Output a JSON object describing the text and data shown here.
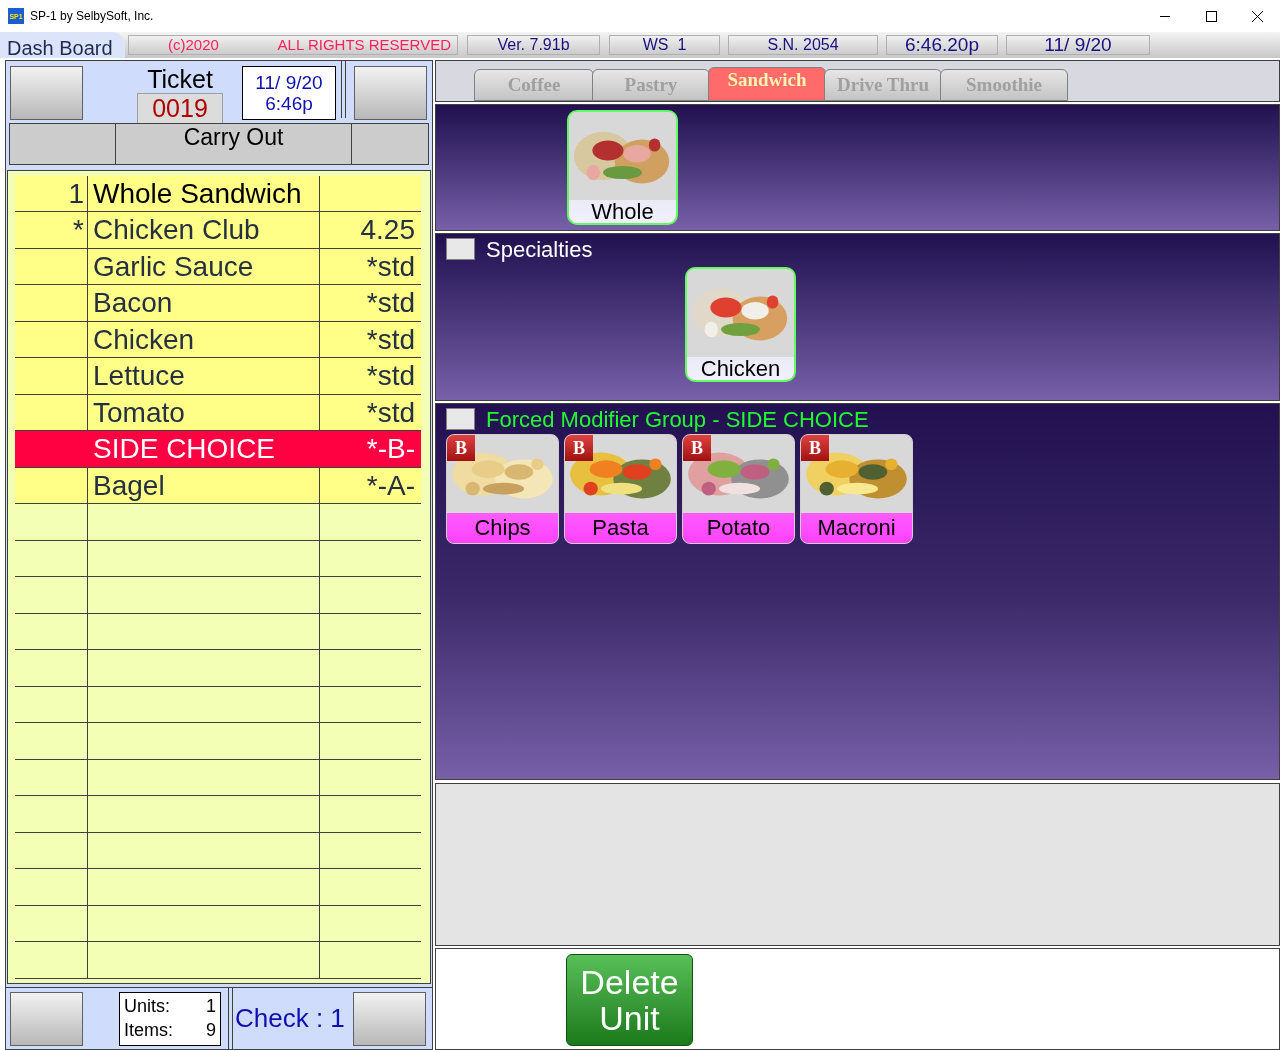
{
  "window": {
    "title": "SP-1 by SelbySoft, Inc.",
    "app_icon": "SP1"
  },
  "info_bar": {
    "dash_board": "Dash Board",
    "copyright": "(c)2020",
    "rights": "ALL RIGHTS RESERVED",
    "version": "Ver. 7.91b",
    "workstation": "WS  1",
    "serial": "S.N. 2054",
    "time": "6:46.20p",
    "date": "11/ 9/20"
  },
  "ticket": {
    "label": "Ticket",
    "number": "0019",
    "date": "11/ 9/20",
    "time": "6:46p",
    "order_type": "Carry Out"
  },
  "order_lines": [
    {
      "qty": "1",
      "name": "Whole Sandwich",
      "selected": false
    },
    {
      "qty": "*",
      "name": "Chicken Club",
      "price": "4.25",
      "selected": false
    },
    {
      "name": "Garlic Sauce",
      "price": "*std",
      "selected": false
    },
    {
      "name": "Bacon",
      "price": "*std",
      "selected": false
    },
    {
      "name": "Chicken",
      "price": "*std",
      "selected": false
    },
    {
      "name": "Lettuce",
      "price": "*std",
      "selected": false
    },
    {
      "name": "Tomato",
      "price": "*std",
      "selected": false
    },
    {
      "name": "SIDE CHOICE",
      "price": "*-B-",
      "selected": true
    },
    {
      "name": "Bagel",
      "price": "*-A-",
      "selected": false
    }
  ],
  "totals": {
    "units_label": "Units:",
    "units": "1",
    "items_label": "Items:",
    "items": "9",
    "check": "Check : 1"
  },
  "tabs": [
    {
      "label": "Coffee",
      "selected": false
    },
    {
      "label": "Pastry",
      "selected": false
    },
    {
      "label": "Sandwich",
      "selected": true
    },
    {
      "label": "Drive Thru",
      "selected": false
    },
    {
      "label": "Smoothie",
      "selected": false
    }
  ],
  "sections": [
    {
      "kind": "plain",
      "buttons": [
        {
          "label": "Whole"
        }
      ]
    },
    {
      "kind": "group",
      "title": "Specialties",
      "checked": false,
      "buttons": [
        {
          "label": "Chicken"
        }
      ]
    },
    {
      "kind": "forced",
      "title": "Forced Modifier Group - SIDE CHOICE",
      "checked": false,
      "buttons": [
        {
          "label": "Chips",
          "badge": "B"
        },
        {
          "label": "Pasta",
          "badge": "B"
        },
        {
          "label": "Potato",
          "badge": "B"
        },
        {
          "label": "Macroni",
          "badge": "B"
        }
      ]
    }
  ],
  "action_button": "Delete Unit"
}
